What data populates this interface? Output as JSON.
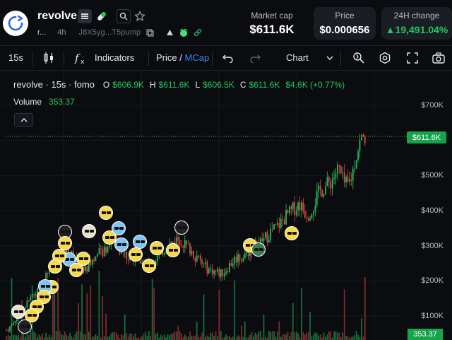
{
  "header": {
    "token_name": "revolve",
    "short_symbol": "r...",
    "age": "4h",
    "address": "J8X5yg...T5pump",
    "market_cap_label": "Market cap",
    "market_cap_value": "$611.6K",
    "price_label": "Price",
    "price_value": "$0.000656",
    "change_label": "24H change",
    "change_value": "▲19,491.04%"
  },
  "toolbar": {
    "interval": "15s",
    "indicators_label": "Indicators",
    "price_label": "Price",
    "slash": "/",
    "mcap_label": "MCap",
    "chart_label": "Chart"
  },
  "legend": {
    "title": "revolve · 15s · fomo",
    "o_key": "O",
    "o_val": "$606.9K",
    "h_key": "H",
    "h_val": "$611.6K",
    "l_key": "L",
    "l_val": "$606.5K",
    "c_key": "C",
    "c_val": "$611.6K",
    "change": "$4.6K (+0.77%)",
    "volume_label": "Volume",
    "volume_value": "353.37"
  },
  "colors": {
    "up": "#22c55e",
    "down": "#ef4444",
    "accent": "#3b82f6",
    "background": "#0b0c10"
  },
  "chart_data": {
    "type": "candlestick",
    "title": "revolve · 15s · fomo",
    "y_tick_labels": [
      "$700K",
      "$600K",
      "$500K",
      "$400K",
      "$300K",
      "$200K",
      "$100K"
    ],
    "y_ticks": [
      700,
      600,
      500,
      400,
      300,
      200,
      100
    ],
    "y_unit": "$K",
    "ylim": [
      70,
      770
    ],
    "last_price_label": "$611.6K",
    "last_price": 611.6,
    "last_volume_label": "353.37",
    "grid": true,
    "series": [
      {
        "name": "price",
        "values": [
          60,
          70,
          90,
          110,
          125,
          140,
          160,
          170,
          190,
          215,
          240,
          250,
          265,
          280,
          290,
          270,
          255,
          240,
          230,
          250,
          265,
          275,
          285,
          300,
          320,
          315,
          290,
          275,
          260,
          270,
          265,
          250,
          240,
          255,
          265,
          275,
          290,
          300,
          310,
          320,
          315,
          300,
          290,
          275,
          260,
          245,
          235,
          230,
          225,
          220,
          230,
          245,
          260,
          270,
          265,
          280,
          290,
          300,
          310,
          320,
          335,
          345,
          355,
          370,
          385,
          395,
          410,
          420,
          400,
          390,
          410,
          440,
          460,
          470,
          480,
          500,
          520,
          480,
          470,
          500,
          560,
          600,
          611.6
        ]
      }
    ]
  }
}
